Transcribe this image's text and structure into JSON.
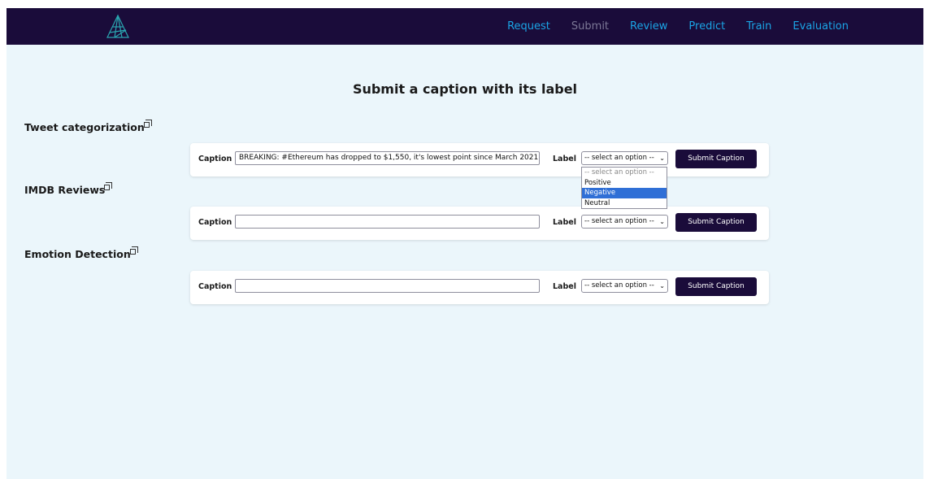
{
  "nav": {
    "links": [
      "Request",
      "Submit",
      "Review",
      "Predict",
      "Train",
      "Evaluation"
    ],
    "active": "Submit"
  },
  "page": {
    "title": "Submit a caption with its label"
  },
  "sections": [
    {
      "heading": "Tweet categorization",
      "caption_label": "Caption",
      "caption_value": "BREAKING: #Ethereum has dropped to $1,550, it's lowest point since March 2021.",
      "label_label": "Label",
      "select_value": "-- select an option --",
      "button": "Submit Caption"
    },
    {
      "heading": "IMDB Reviews",
      "caption_label": "Caption",
      "caption_value": "",
      "label_label": "Label",
      "select_value": "-- select an option --",
      "button": "Submit Caption"
    },
    {
      "heading": "Emotion Detection",
      "caption_label": "Caption",
      "caption_value": "",
      "label_label": "Label",
      "select_value": "-- select an option --",
      "button": "Submit Caption"
    }
  ],
  "dropdown": {
    "options": [
      "-- select an option --",
      "Positive",
      "Negative",
      "Neutral"
    ],
    "highlighted": "Negative"
  },
  "colors": {
    "navbar": "#1a0c3a",
    "nav_link": "#1aa5e6",
    "nav_active": "#7c7896",
    "page_bg": "#ebf6fb",
    "button_bg": "#1a0c3a",
    "highlight": "#2f6fd6"
  }
}
